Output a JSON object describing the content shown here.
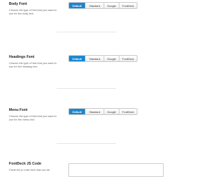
{
  "font_sources": [
    "Default",
    "Standard",
    "Google",
    "FontDeck"
  ],
  "settings": [
    {
      "title": "Body Font",
      "description": "Choose the type of font that you want to use for the body text.",
      "selected": "Default"
    },
    {
      "title": "Headings Font",
      "description": "Choose the type of font that you want to use for the heading text.",
      "selected": "Default"
    },
    {
      "title": "Menu Font",
      "description": "Choose the type of font that you want to use for the menu text.",
      "selected": "Default"
    }
  ],
  "fontdeck": {
    "title": "FontDeck JS Code",
    "description": "Paste the js code here that can be",
    "value": ""
  },
  "colors": {
    "active": "#1c87d0"
  }
}
